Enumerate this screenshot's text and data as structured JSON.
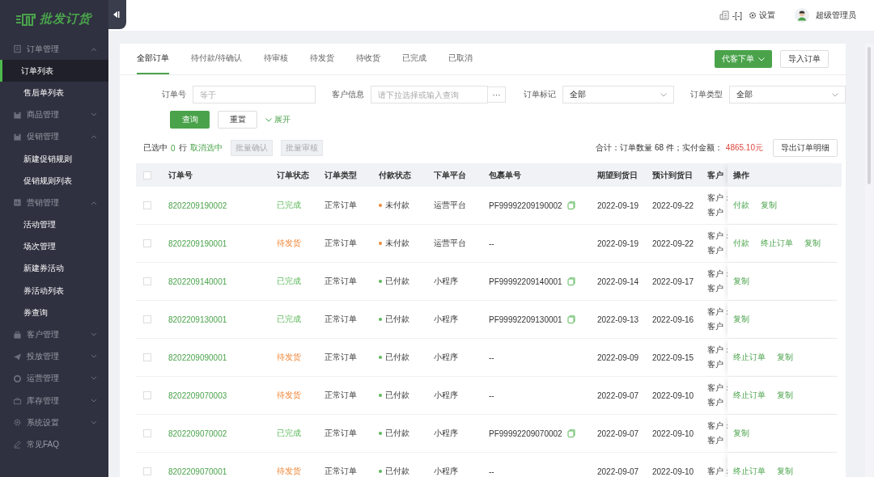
{
  "logo": "批发订货",
  "sidebar": {
    "groups": [
      {
        "label": "订单管理",
        "expanded": true,
        "children": [
          {
            "label": "订单列表",
            "selected": true
          },
          {
            "label": "售后单列表",
            "selected": false
          }
        ]
      },
      {
        "label": "商品管理",
        "expanded": false
      },
      {
        "label": "促销管理",
        "expanded": true,
        "children": [
          {
            "label": "新建促销规则",
            "selected": false
          },
          {
            "label": "促销规则列表",
            "selected": false
          }
        ]
      },
      {
        "label": "营销管理",
        "expanded": true,
        "children": [
          {
            "label": "活动管理",
            "selected": false
          },
          {
            "label": "场次管理",
            "selected": false
          },
          {
            "label": "新建券活动",
            "selected": false
          },
          {
            "label": "券活动列表",
            "selected": false
          },
          {
            "label": "券查询",
            "selected": false
          }
        ]
      },
      {
        "label": "客户管理",
        "expanded": false
      },
      {
        "label": "投放管理",
        "expanded": false
      },
      {
        "label": "运营管理",
        "expanded": false
      },
      {
        "label": "库存管理",
        "expanded": false
      },
      {
        "label": "系统设置",
        "expanded": false
      },
      {
        "label": "常见FAQ"
      }
    ]
  },
  "header": {
    "store": "-[-]",
    "settings": "设置",
    "user": "超级管理员"
  },
  "tabs": [
    {
      "label": "全部订单",
      "selected": true
    },
    {
      "label": "待付款/待确认",
      "selected": false
    },
    {
      "label": "待审核",
      "selected": false
    },
    {
      "label": "待发货",
      "selected": false
    },
    {
      "label": "待收货",
      "selected": false
    },
    {
      "label": "已完成",
      "selected": false
    },
    {
      "label": "已取消",
      "selected": false
    }
  ],
  "top_buttons": {
    "proxy_order": "代客下单",
    "import": "导入订单"
  },
  "filters": {
    "order_no": {
      "label": "订单号",
      "placeholder": "等于"
    },
    "customer": {
      "label": "客户信息",
      "placeholder": "请下拉选择或输入查询",
      "more": "···"
    },
    "mark": {
      "label": "订单标记",
      "value": "全部"
    },
    "type": {
      "label": "订单类型",
      "value": "全部"
    }
  },
  "actions": {
    "search": "查询",
    "reset": "重置",
    "expand": "展开"
  },
  "selection": {
    "prefix": "已选中",
    "count": "0",
    "suffix": "行",
    "clear": "取消选中",
    "batch": [
      "批量确认",
      "批量审核"
    ]
  },
  "summary": {
    "text": "合计：订单数量 68 件；实付金额：",
    "amount": "4865.10元",
    "export": "导出订单明细"
  },
  "table": {
    "all_checked": false,
    "columns": [
      "订单号",
      "订单状态",
      "订单类型",
      "付款状态",
      "下单平台",
      "包裹单号",
      "期望到货日",
      "预计到货日",
      "客户",
      "操作"
    ],
    "rows": [
      {
        "checked": false,
        "order": "8202209190002",
        "status": "已完成",
        "completed": true,
        "type": "正常订单",
        "pay": "未付款",
        "paid": false,
        "platform": "运营平台",
        "package": "PF99992209190002",
        "copyable": true,
        "expected": "2022-09-19",
        "estimated": "2022-09-22",
        "customer": [
          "客户：",
          "客户"
        ],
        "actions": [
          "付款",
          "复制"
        ]
      },
      {
        "checked": false,
        "order": "8202209190001",
        "status": "待发货",
        "completed": false,
        "type": "正常订单",
        "pay": "未付款",
        "paid": false,
        "platform": "运营平台",
        "package": "--",
        "copyable": false,
        "expected": "2022-09-19",
        "estimated": "2022-09-22",
        "customer": [
          "客户：",
          "客户"
        ],
        "actions": [
          "付款",
          "终止订单",
          "复制"
        ]
      },
      {
        "checked": false,
        "order": "8202209140001",
        "status": "已完成",
        "completed": true,
        "type": "正常订单",
        "pay": "已付款",
        "paid": true,
        "platform": "小程序",
        "package": "PF99992209140001",
        "copyable": true,
        "expected": "2022-09-14",
        "estimated": "2022-09-17",
        "customer": [
          "客户：",
          "客户"
        ],
        "actions": [
          "复制"
        ]
      },
      {
        "checked": false,
        "order": "8202209130001",
        "status": "已完成",
        "completed": true,
        "type": "正常订单",
        "pay": "已付款",
        "paid": true,
        "platform": "小程序",
        "package": "PF99992209130001",
        "copyable": true,
        "expected": "2022-09-13",
        "estimated": "2022-09-16",
        "customer": [
          "客户：",
          "客户"
        ],
        "actions": [
          "复制"
        ]
      },
      {
        "checked": false,
        "order": "8202209090001",
        "status": "待发货",
        "completed": false,
        "type": "正常订单",
        "pay": "已付款",
        "paid": true,
        "platform": "小程序",
        "package": "--",
        "copyable": false,
        "expected": "2022-09-09",
        "estimated": "2022-09-15",
        "customer": [
          "客户：",
          "客户"
        ],
        "actions": [
          "终止订单",
          "复制"
        ]
      },
      {
        "checked": false,
        "order": "8202209070003",
        "status": "待发货",
        "completed": false,
        "type": "正常订单",
        "pay": "已付款",
        "paid": true,
        "platform": "小程序",
        "package": "--",
        "copyable": false,
        "expected": "2022-09-07",
        "estimated": "2022-09-10",
        "customer": [
          "客户：",
          "客户"
        ],
        "actions": [
          "终止订单",
          "复制"
        ]
      },
      {
        "checked": false,
        "order": "8202209070002",
        "status": "已完成",
        "completed": true,
        "type": "正常订单",
        "pay": "已付款",
        "paid": true,
        "platform": "小程序",
        "package": "PF99992209070002",
        "copyable": true,
        "expected": "2022-09-07",
        "estimated": "2022-09-10",
        "customer": [
          "客户：",
          "客户"
        ],
        "actions": [
          "复制"
        ]
      },
      {
        "checked": false,
        "order": "8202209070001",
        "status": "待发货",
        "completed": false,
        "type": "正常订单",
        "pay": "已付款",
        "paid": true,
        "platform": "小程序",
        "package": "--",
        "copyable": false,
        "expected": "2022-09-07",
        "estimated": "2022-09-10",
        "customer": [
          "客户："
        ],
        "actions": [
          "终止订单",
          "复制"
        ]
      }
    ]
  }
}
